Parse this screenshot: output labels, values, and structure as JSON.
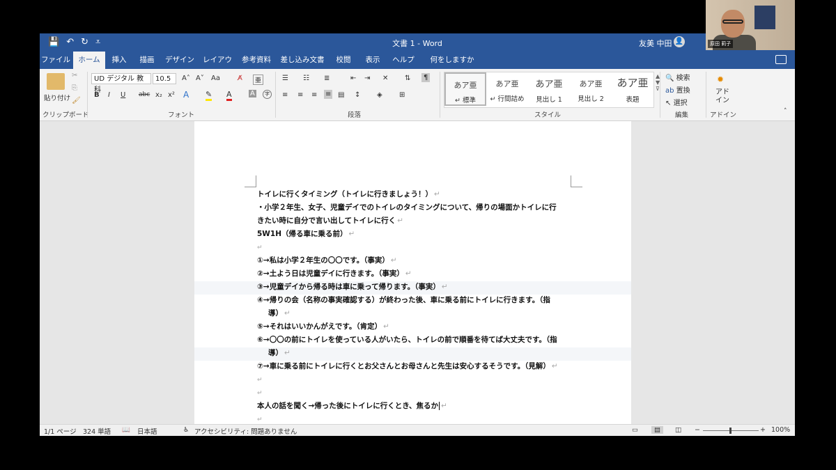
{
  "window": {
    "title": "文書 1  -  Word",
    "user_name": "友美 中田",
    "avatar_glyph": "👤"
  },
  "qat": {
    "save": "💾",
    "undo": "↶",
    "redo": "↻",
    "customize": "⩡"
  },
  "tabs": [
    {
      "label": "ファイル",
      "active": false
    },
    {
      "label": "ホーム",
      "active": true
    },
    {
      "label": "挿入",
      "active": false
    },
    {
      "label": "描画",
      "active": false
    },
    {
      "label": "デザイン",
      "active": false
    },
    {
      "label": "レイアウト",
      "active": false
    },
    {
      "label": "参考資料",
      "active": false
    },
    {
      "label": "差し込み文書",
      "active": false
    },
    {
      "label": "校閲",
      "active": false
    },
    {
      "label": "表示",
      "active": false
    },
    {
      "label": "ヘルプ",
      "active": false
    },
    {
      "label": "何をしますか",
      "active": false
    }
  ],
  "ribbon": {
    "clipboard": {
      "label": "クリップボード",
      "paste": "貼り付け"
    },
    "font": {
      "label": "フォント",
      "font_name": "UD デジタル 教科",
      "font_size": "10.5",
      "bold": "B",
      "italic": "I",
      "underline": "U",
      "strike": "abc",
      "subscript": "x₂",
      "superscript": "x²",
      "grow": "A˄",
      "shrink": "A˅",
      "case": "Aa"
    },
    "paragraph": {
      "label": "段落"
    },
    "styles": {
      "label": "スタイル",
      "items": [
        {
          "preview": "あア亜",
          "name": "↵ 標準"
        },
        {
          "preview": "あア亜",
          "name": "↵ 行間詰め"
        },
        {
          "preview": "あア亜",
          "name": "見出し 1"
        },
        {
          "preview": "あア亜",
          "name": "見出し 2"
        },
        {
          "preview": "あア亜",
          "name": "表題"
        }
      ]
    },
    "editing": {
      "label": "編集",
      "find": "検索",
      "replace": "置換",
      "select": "選択"
    },
    "addins": {
      "label": "アドイン",
      "addins_button": "アド\nイン"
    }
  },
  "document": {
    "paragraphs": [
      "トイレに行くタイミング（トイレに行きましょう！）",
      "・小学２年生、女子、児童デイでのトイレのタイミングについて、帰りの場面かトイレに行",
      "きたい時に自分で言い出してトイレに行く",
      "5W1H（帰る車に乗る前）",
      "",
      "①→私は小学２年生の〇〇です。（事実）",
      "②→土よう日は児童デイに行きます。（事実）",
      "③→児童デイから帰る時は車に乗って帰ります。（事実）",
      "④→帰りの会（名称の事実確認する）が終わった後、車に乗る前にトイレに行きます。（指",
      "導）",
      "⑤→それはいいかんがえです。（肯定）",
      "⑥→〇〇の前にトイレを使っている人がいたら、トイレの前で順番を待てば大丈夫です。（指",
      "導）",
      "⑦→車に乗る前にトイレに行くとお父さんとお母さんと先生は安心するそうです。（見解）",
      "",
      "",
      "本人の話を聞く→帰った後にトイレに行くとき、焦るか",
      ""
    ],
    "paragraph_mark": "↵"
  },
  "status": {
    "page": "1/1 ページ",
    "words": "324 単語",
    "language": "日本語",
    "accessibility": "アクセシビリティ: 問題ありません",
    "zoom": "100%"
  },
  "webcam": {
    "name_tag": "原田 莉子"
  }
}
